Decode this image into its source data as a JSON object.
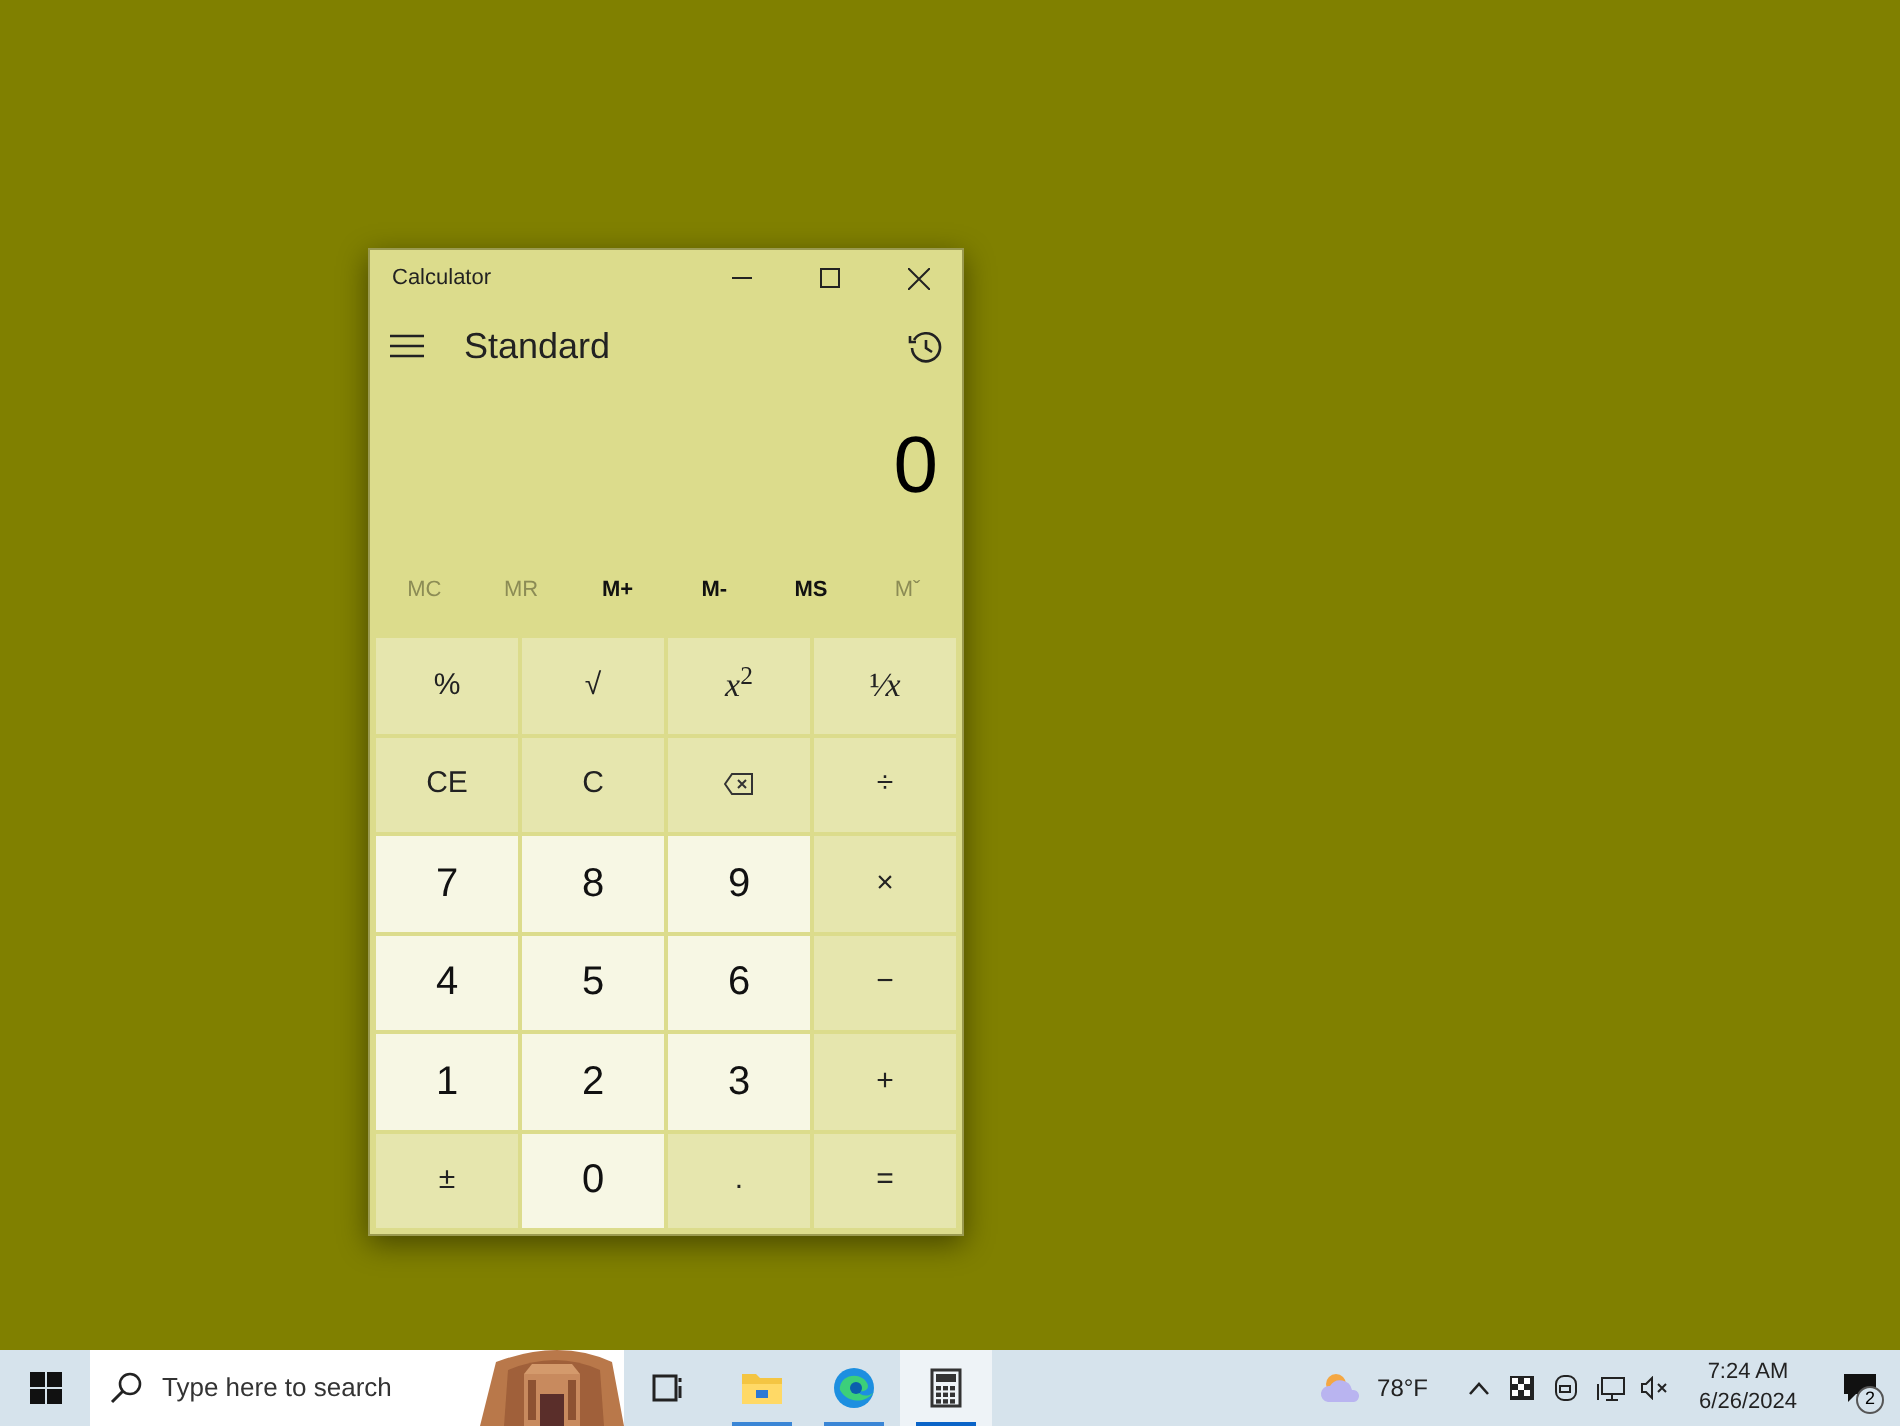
{
  "window": {
    "title": "Calculator"
  },
  "header": {
    "mode": "Standard"
  },
  "display": {
    "value": "0"
  },
  "memory": [
    {
      "label": "MC",
      "disabled": true
    },
    {
      "label": "MR",
      "disabled": true
    },
    {
      "label": "M+",
      "disabled": false
    },
    {
      "label": "M-",
      "disabled": false
    },
    {
      "label": "MS",
      "disabled": false
    },
    {
      "label": "Mˇ",
      "disabled": true
    }
  ],
  "keys": [
    {
      "label": "%",
      "kind": "function"
    },
    {
      "label": "√",
      "kind": "function"
    },
    {
      "label": "*x*$^{2}$",
      "kind": "function"
    },
    {
      "label": "¹⁄*x*",
      "kind": "function"
    },
    {
      "label": "CE",
      "kind": "function"
    },
    {
      "label": "C",
      "kind": "function"
    },
    {
      "kind": "backspace"
    },
    {
      "label": "÷",
      "kind": "function"
    },
    {
      "label": "7",
      "kind": "digit"
    },
    {
      "label": "8",
      "kind": "digit"
    },
    {
      "label": "9",
      "kind": "digit"
    },
    {
      "label": "×",
      "kind": "function"
    },
    {
      "label": "4",
      "kind": "digit"
    },
    {
      "label": "5",
      "kind": "digit"
    },
    {
      "label": "6",
      "kind": "digit"
    },
    {
      "label": "−",
      "kind": "function"
    },
    {
      "label": "1",
      "kind": "digit"
    },
    {
      "label": "2",
      "kind": "digit"
    },
    {
      "label": "3",
      "kind": "digit"
    },
    {
      "label": "+",
      "kind": "function"
    },
    {
      "label": "±",
      "kind": "function"
    },
    {
      "label": "0",
      "kind": "digit"
    },
    {
      "label": ".",
      "kind": "function"
    },
    {
      "label": "=",
      "kind": "function"
    }
  ],
  "taskbar": {
    "search": {
      "placeholder": "Type here to search"
    },
    "apps": [
      {
        "kind": "taskview",
        "selected": false
      },
      {
        "kind": "explorer",
        "selected": false
      },
      {
        "kind": "edge",
        "selected": false
      },
      {
        "kind": "calculator",
        "selected": true
      }
    ],
    "weather": "78°F",
    "time": "7:24 AM",
    "date": "6/26/2024",
    "notifications": "2"
  }
}
